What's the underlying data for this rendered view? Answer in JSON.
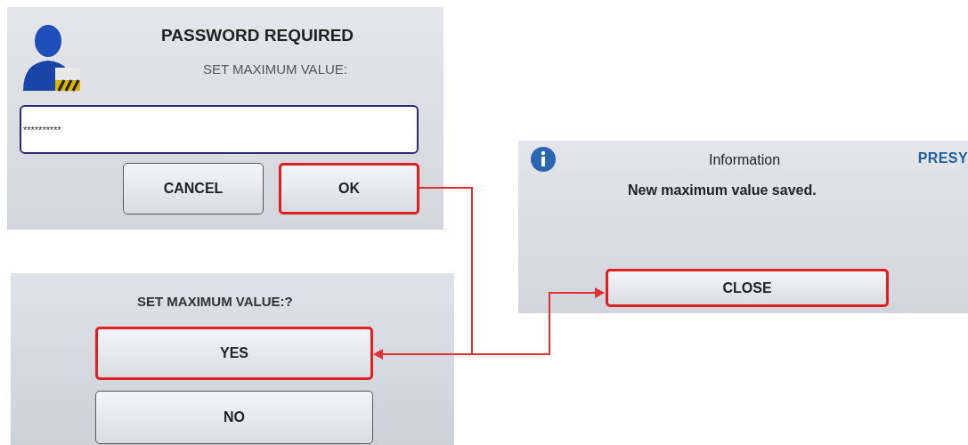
{
  "password_dialog": {
    "title": "PASSWORD REQUIRED",
    "subtitle": "SET MAXIMUM VALUE:",
    "password_field": {
      "value": "**********"
    },
    "buttons": [
      {
        "label": "CANCEL",
        "highlighted": false
      },
      {
        "label": "OK",
        "highlighted": true
      }
    ]
  },
  "info_dialog": {
    "title": "Information",
    "logo": "PRESY",
    "message": "New maximum value saved.",
    "buttons": [
      {
        "label": "CLOSE",
        "highlighted": true
      }
    ]
  },
  "confirm_dialog": {
    "title": "SET MAXIMUM VALUE:?",
    "buttons": [
      {
        "label": "YES",
        "highlighted": true
      },
      {
        "label": "NO",
        "highlighted": false
      }
    ]
  }
}
